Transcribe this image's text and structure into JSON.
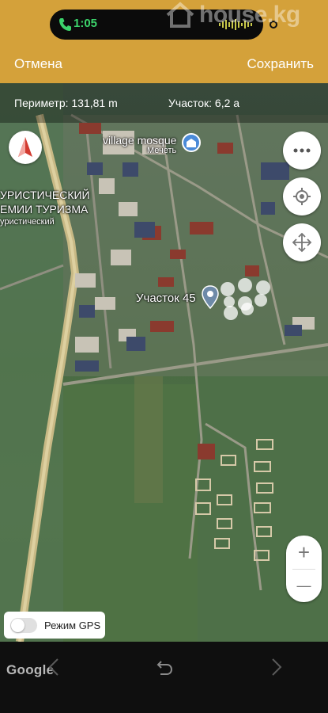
{
  "status_bar": {
    "time": "1:05",
    "watermark": "house.kg"
  },
  "nav": {
    "cancel_label": "Отмена",
    "save_label": "Сохранить"
  },
  "measurements": {
    "perimeter": "Периметр: 131,81 m",
    "area": "Участок: 6,2 а"
  },
  "map": {
    "labels": {
      "village_mosque": "village mosque",
      "mosque": "Мечеть",
      "tourism_line1": "УРИСТИЧЕСКИЙ",
      "tourism_line2": "ЕМИИ ТУРИЗМА",
      "tourism_line3": "уристический",
      "plot": "Участок 45"
    },
    "attribution": "Google"
  },
  "controls": {
    "more_icon": "more-horizontal-icon",
    "locate_icon": "locate-icon",
    "move_icon": "move-arrows-icon",
    "zoom_in": "+",
    "zoom_out": "—"
  },
  "gps": {
    "label": "Режим GPS",
    "enabled": false
  },
  "colors": {
    "accent": "#d4a13a",
    "call_green": "#3cd36b",
    "pin_blue": "#4a8ad8"
  }
}
